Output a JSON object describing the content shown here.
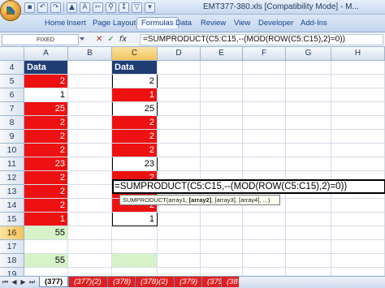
{
  "window": {
    "title": "EMT377-380.xls  [Compatibility Mode] - M..."
  },
  "quick_access": {
    "icons": [
      "save-icon",
      "undo-icon",
      "redo-icon",
      "warning-icon",
      "text-a-icon",
      "cut-icon",
      "zoom-icon",
      "sort-icon",
      "filter-icon",
      "customize-icon"
    ]
  },
  "ribbon": {
    "tabs": [
      "Home",
      "Insert",
      "Page Layout",
      "Formulas",
      "Data",
      "Review",
      "View",
      "Developer",
      "Add-Ins"
    ],
    "active_tab": "Formulas"
  },
  "formula_bar": {
    "name_box": "FIXED",
    "icons": {
      "cancel": "✕",
      "enter": "✓",
      "fx": "fx"
    },
    "formula": "=SUMPRODUCT(C5:C15,--(MOD(ROW(C5:C15),2)=0))"
  },
  "sheet": {
    "columns": [
      "A",
      "B",
      "C",
      "D",
      "E",
      "F",
      "G",
      "H"
    ],
    "active_column": "C",
    "rows": [
      {
        "num": "4",
        "a": "Data",
        "c": "Data"
      },
      {
        "num": "5",
        "a": "2",
        "c": "2"
      },
      {
        "num": "6",
        "a": "1",
        "c": "1"
      },
      {
        "num": "7",
        "a": "25",
        "c": "25"
      },
      {
        "num": "8",
        "a": "2",
        "c": "2"
      },
      {
        "num": "9",
        "a": "2",
        "c": "2"
      },
      {
        "num": "10",
        "a": "2",
        "c": "2"
      },
      {
        "num": "11",
        "a": "23",
        "c": "23"
      },
      {
        "num": "12",
        "a": "2",
        "c": "2"
      },
      {
        "num": "13",
        "a": "2",
        "c": "2"
      },
      {
        "num": "14",
        "a": "2",
        "c": "2"
      },
      {
        "num": "15",
        "a": "1",
        "c": "1"
      },
      {
        "num": "16",
        "a": "55",
        "c": ""
      },
      {
        "num": "17",
        "a": "",
        "c": ""
      },
      {
        "num": "18",
        "a": "55",
        "c": ""
      },
      {
        "num": "19",
        "a": "",
        "c": ""
      }
    ],
    "active_row": "16",
    "fill_colors": {
      "red": "#ee1111",
      "header": "#1f3c73",
      "green": "#d6f2c8"
    }
  },
  "editing": {
    "formula_display": "=SUMPRODUCT(C5:C15,--(MOD(ROW(C5:C15),2)=0))",
    "tooltip_parts": [
      "SUMPRODUCT(array1, ",
      "[array2]",
      ", [array3], [array4], ...)"
    ]
  },
  "sheet_tabs": {
    "active": "(377)",
    "others": [
      "(377)(2)",
      "(378)",
      "(378)(2)",
      "(379)",
      "(379)(2)",
      "(38"
    ]
  }
}
